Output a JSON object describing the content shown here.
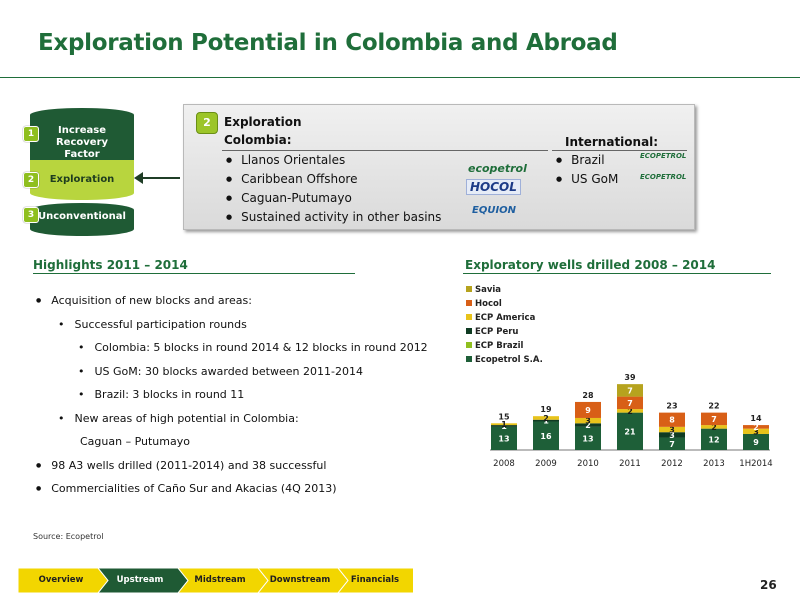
{
  "header": {
    "title": "Exploration Potential in Colombia and Abroad"
  },
  "pillars": [
    {
      "num": "1",
      "label": "Increase Recovery Factor"
    },
    {
      "num": "2",
      "label": "Exploration"
    },
    {
      "num": "3",
      "label": "Unconventional"
    }
  ],
  "exploration_box": {
    "badge": "2",
    "title": "Exploration",
    "colombia_heading": "Colombia:",
    "colombia_items": [
      "Llanos Orientales",
      "Caribbean Offshore",
      "Caguan-Putumayo",
      "Sustained activity in other basins"
    ],
    "international_heading": "International:",
    "international_items": [
      "Brazil",
      "US GoM"
    ],
    "logos": {
      "ecopetrol": "ecopetrol",
      "hocol": "HOCOL",
      "equion": "EQUION",
      "ecp_brasil": "ECOPETROL",
      "ecp_america": "ECOPETROL"
    }
  },
  "highlights": {
    "title": "Highlights 2011 – 2014",
    "items": [
      {
        "text": "Acquisition of new blocks and areas:",
        "level": 1
      },
      {
        "text": "Successful participation rounds",
        "level": 2
      },
      {
        "text": "Colombia: 5 blocks in round 2014 & 12 blocks in round 2012",
        "level": 3
      },
      {
        "text": "US GoM: 30 blocks awarded between 2011-2014",
        "level": 3
      },
      {
        "text": "Brazil: 3 blocks in round 11",
        "level": 3
      },
      {
        "text": "New areas of high potential in Colombia:",
        "level": 2
      },
      {
        "text": "Caguan – Putumayo",
        "level": 0
      },
      {
        "text": "98 A3 wells drilled (2011-2014) and 38 successful",
        "level": 1
      },
      {
        "text": "Commercialities of Caño Sur and Akacias (4Q 2013)",
        "level": 1
      }
    ]
  },
  "source": "Source: Ecopetrol",
  "chart_title": "Exploratory wells drilled  2008 – 2014",
  "chart_data": {
    "type": "bar",
    "stacked": true,
    "categories": [
      "2008",
      "2009",
      "2010",
      "2011",
      "2012",
      "2013",
      "1H2014"
    ],
    "series": [
      {
        "name": "Ecopetrol S.A.",
        "color": "#1e5f38",
        "values": [
          13,
          16,
          13,
          21,
          7,
          12,
          9
        ]
      },
      {
        "name": "ECP Brazil",
        "color": "#8fbf1f",
        "values": [
          0,
          0,
          0,
          0,
          0,
          0,
          0
        ]
      },
      {
        "name": "ECP Peru",
        "color": "#0f3b22",
        "values": [
          1,
          1,
          2,
          0,
          3,
          0,
          0
        ]
      },
      {
        "name": "ECP America",
        "color": "#e8c31b",
        "values": [
          1,
          2,
          3,
          2,
          3,
          2,
          3
        ]
      },
      {
        "name": "Hocol",
        "color": "#d85f17",
        "values": [
          0,
          0,
          9,
          7,
          8,
          7,
          2
        ]
      },
      {
        "name": "Savia",
        "color": "#b6a31e",
        "values": [
          0,
          0,
          0,
          7,
          0,
          0,
          0
        ]
      }
    ],
    "extra_labels": [
      {
        "category": "2011",
        "value": "2",
        "series": "ECP America"
      },
      {
        "category": "2012",
        "value": "2",
        "series": "ECP America"
      },
      {
        "category": "2013",
        "value": "1",
        "series": "Hocol"
      }
    ],
    "totals": [
      15,
      19,
      28,
      39,
      23,
      22,
      14
    ],
    "legend": [
      "Savia",
      "Hocol",
      "ECP America",
      "ECP Peru",
      "ECP Brazil",
      "Ecopetrol S.A."
    ],
    "legend_position": "top-left",
    "ylim": [
      0,
      42
    ],
    "grid": false
  },
  "nav": {
    "tabs": [
      "Overview",
      "Upstream",
      "Midstream",
      "Downstream",
      "Financials"
    ],
    "active": "Upstream"
  },
  "page_number": "26"
}
